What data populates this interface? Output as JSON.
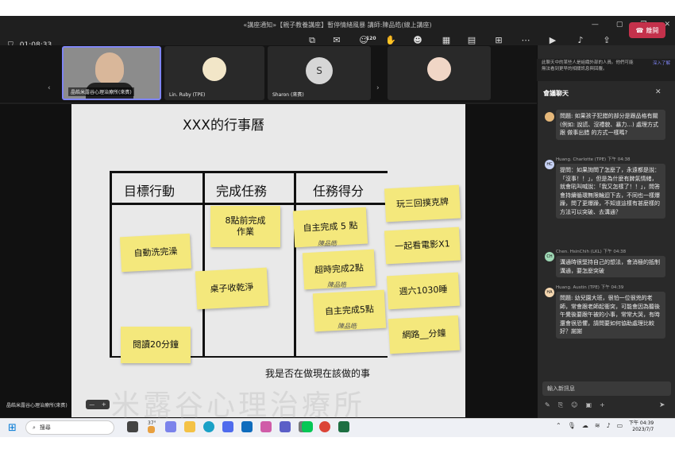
{
  "window": {
    "title": "«講座通知»【親子教養講座】暫停情緒風暴 講師:陳品皓(線上講座)",
    "ctl": [
      "—",
      "▢",
      "❐",
      "✕"
    ]
  },
  "toolbar": {
    "timer": "01:08:33",
    "buttons": [
      {
        "label": "彈出視窗",
        "icon": "popout-icon"
      },
      {
        "label": "聊天",
        "icon": "chat-icon"
      },
      {
        "label": "人員",
        "icon": "people-icon",
        "count": "120"
      },
      {
        "label": "舉手",
        "icon": "hand-icon"
      },
      {
        "label": "傳送表情符號",
        "icon": "emoji-icon"
      },
      {
        "label": "檢視",
        "icon": "view-icon"
      },
      {
        "label": "記錄",
        "icon": "notes-icon"
      },
      {
        "label": "應用程式",
        "icon": "apps-icon"
      },
      {
        "label": "其他",
        "icon": "more-icon"
      },
      {
        "label": "照相機",
        "icon": "camera-icon"
      },
      {
        "label": "麥克風",
        "icon": "mic-icon"
      },
      {
        "label": "分享",
        "icon": "share-icon"
      }
    ],
    "leave": "離開"
  },
  "participants": [
    {
      "name": "晶皓米露谷心理治療所(來賓)"
    },
    {
      "name": "Lin. Ruby (TPE)"
    },
    {
      "name": "Sharon (來賓)",
      "initial": "S"
    },
    {
      "name": ""
    }
  ],
  "slide": {
    "title": "XXX的行事曆",
    "headers": [
      "目標行動",
      "完成任務",
      "任務得分"
    ],
    "notes": [
      "自動洗完澡",
      "閱讀20分鐘",
      "8點前完成作業",
      "桌子收乾淨",
      "自主完成 5 點",
      "超時完成2點",
      "自主完成5點",
      "玩三回撲克牌",
      "一起看電影X1",
      "週六1030睡",
      "網路__分鐘"
    ],
    "sigs": [
      "陳品皓",
      "陳品皓",
      "陳品皓"
    ],
    "footer": "我是否在做現在該做的事"
  },
  "watermark": "米露谷心理治療所",
  "presenter": "晶皓米露谷心理治療所(來賓)",
  "zoom": {
    "minus": "—",
    "plus": "+"
  },
  "notice": {
    "text": "此聊天中的某些人是組織外部的人員。他們可能無法看到更早的相關訊息與回覆。",
    "link": "深入了解"
  },
  "chat": {
    "title": "會議聊天",
    "messages": [
      {
        "who": "",
        "text": "問題: 如果孩子犯錯的部分是跟品格有關(例如: 說謊、沒禮貌、暴力...) 處理方式跟 做事出錯 的方式一樣嗎?",
        "init": "",
        "color": "#e6b87a"
      },
      {
        "who": "Huang. Charlotte (TPE) 下午 04:38",
        "text": "提問：如果詢問了怎麼了，永遠都是說：「沒事！！」，但是為什麼有脾氣情緒，就會吼叫喊說：「我又怎樣了！！」，問答會持續循環無限輪迴下去，不同也一樣爆躁，問了更爆躁，不知道這樣有甚麼樣的方法可以突破、去溝通？",
        "init": "HC",
        "color": "#c7d2f5"
      },
      {
        "who": "Chen. HsinChih (LKL) 下午 04:38",
        "text": "溝通時很堅持自己的想法，會消極的抵制溝通，要怎麼突破",
        "init": "CH",
        "color": "#9fd8b5"
      },
      {
        "who": "Huang. Austin (TPE) 下午 04:39",
        "text": "問題: 幼兒園大班，很怕一位很兇的老師，常會跟老師起衝突，可能會因為聽後午覺後要跟午被的小事，常常大哭，有時還會很恐懼，請問要如何協助處理比較好？謝謝",
        "init": "HA",
        "color": "#f5d7b0"
      }
    ],
    "input": "輸入新訊息"
  },
  "taskbar": {
    "search": "搜尋",
    "temp": "37°",
    "time": "下午 04:39",
    "date": "2023/7/7"
  }
}
